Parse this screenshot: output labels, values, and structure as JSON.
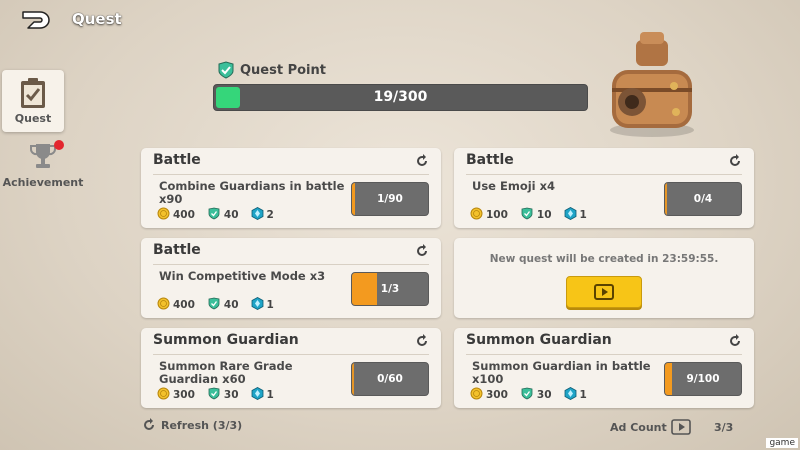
{
  "header": {
    "title": "Quest"
  },
  "sidebar": {
    "tabs": [
      {
        "label": "Quest",
        "active": true
      },
      {
        "label": "Achievement",
        "active": false,
        "has_notification": true
      }
    ]
  },
  "quest_point": {
    "label": "Quest Point",
    "current": 19,
    "max": 300,
    "text": "19/300",
    "fill_color": "#35d67a"
  },
  "cards": [
    {
      "category": "Battle",
      "task": "Combine Guardians in battle x90",
      "rewards": {
        "gold": "400",
        "quest_point": "40",
        "gem": "2"
      },
      "progress_text": "1/90",
      "progress": 0.011
    },
    {
      "category": "Battle",
      "task": "Use Emoji x4",
      "rewards": {
        "gold": "100",
        "quest_point": "10",
        "gem": "1"
      },
      "progress_text": "0/4",
      "progress": 0
    },
    {
      "category": "Battle",
      "task": "Win Competitive Mode x3",
      "rewards": {
        "gold": "400",
        "quest_point": "40",
        "gem": "1"
      },
      "progress_text": "1/3",
      "progress": 0.333
    },
    {
      "category": "Summon Guardian",
      "task": "Summon Rare Grade Guardian x60",
      "rewards": {
        "gold": "300",
        "quest_point": "30",
        "gem": "1"
      },
      "progress_text": "0/60",
      "progress": 0
    },
    {
      "category": "Summon Guardian",
      "task": "Summon Guardian in battle x100",
      "rewards": {
        "gold": "300",
        "quest_point": "30",
        "gem": "1"
      },
      "progress_text": "9/100",
      "progress": 0.09
    }
  ],
  "ad_card": {
    "message": "New quest will be created in 23:59:55."
  },
  "footer": {
    "refresh_label": "Refresh (3/3)",
    "ad_count_label": "Ad Count",
    "ad_count_value": "3/3"
  },
  "watermark": "game",
  "colors": {
    "progress_orange": "#f39a1f",
    "ad_button_yellow": "#f7c517",
    "gold": "#f3c12b",
    "gem": "#1fa4c7"
  }
}
